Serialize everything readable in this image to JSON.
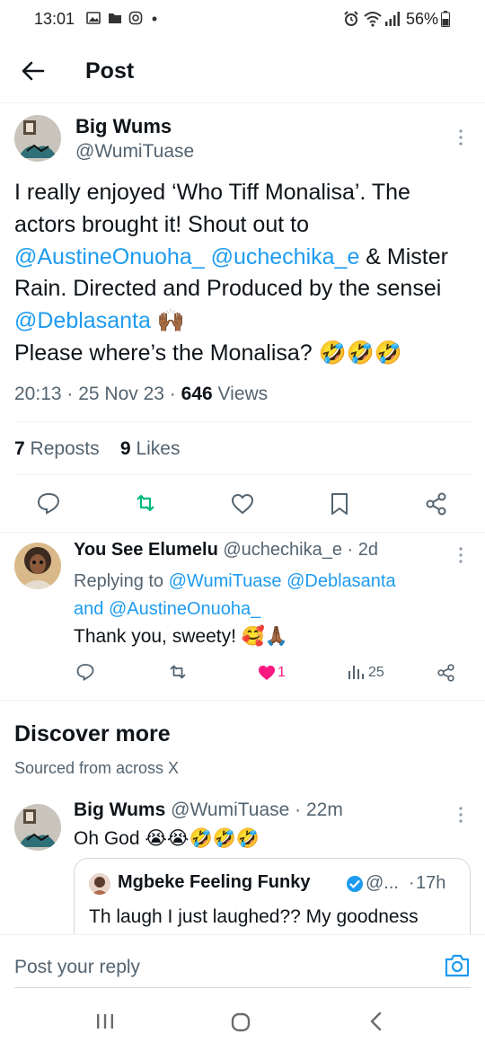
{
  "status_bar": {
    "time": "13:01",
    "battery": "56%"
  },
  "header": {
    "title": "Post"
  },
  "main_post": {
    "author_name": "Big Wums",
    "author_handle": "@WumiTuase",
    "text_segments": [
      {
        "text": "I really enjoyed ‘Who Tiff Monalisa’. The actors brought it! Shout out to ",
        "type": "text"
      },
      {
        "text": "@AustineOnuoha_",
        "type": "mention"
      },
      {
        "text": " ",
        "type": "text"
      },
      {
        "text": "@uchechika_e",
        "type": "mention"
      },
      {
        "text": " & Mister Rain. Directed and Produced by the sensei ",
        "type": "text"
      },
      {
        "text": "@Deblasanta",
        "type": "mention"
      },
      {
        "text": " 🙌🏾",
        "type": "text"
      },
      {
        "text": "\nPlease where’s the Monalisa? 🤣🤣🤣",
        "type": "text"
      }
    ],
    "time": "20:13",
    "date": "25 Nov 23",
    "views_count": "646",
    "views_label": "Views",
    "reposts_count": "7",
    "reposts_label": "Reposts",
    "likes_count": "9",
    "likes_label": "Likes"
  },
  "reply": {
    "author_name": "You See Elumelu",
    "author_handle": "@uchechika_e",
    "age": "2d",
    "replying_prefix": "Replying to",
    "replying_to_1": "@WumiTuase",
    "replying_to_2": "@Deblasanta",
    "replying_and": "and",
    "replying_to_3": "@AustineOnuoha_",
    "text": "Thank you, sweety! 🥰🙏🏾",
    "likes": "1",
    "views": "25",
    "like_color": "#f91880"
  },
  "discover": {
    "title": "Discover more",
    "subtitle": "Sourced from across X"
  },
  "post2": {
    "author_name": "Big Wums",
    "author_handle": "@WumiTuase",
    "age": "22m",
    "text": "Oh God 😭😭🤣🤣🤣",
    "quote": {
      "author_name": "Mgbeke Feeling Funky",
      "handle": "@...",
      "age": "17h",
      "text": "Th laugh I just laughed?? My goodness"
    }
  },
  "reply_bar": {
    "placeholder": "Post your reply"
  },
  "colors": {
    "accent": "#1d9bf0",
    "repost_green": "#00ba7c",
    "like_pink": "#f91880"
  }
}
